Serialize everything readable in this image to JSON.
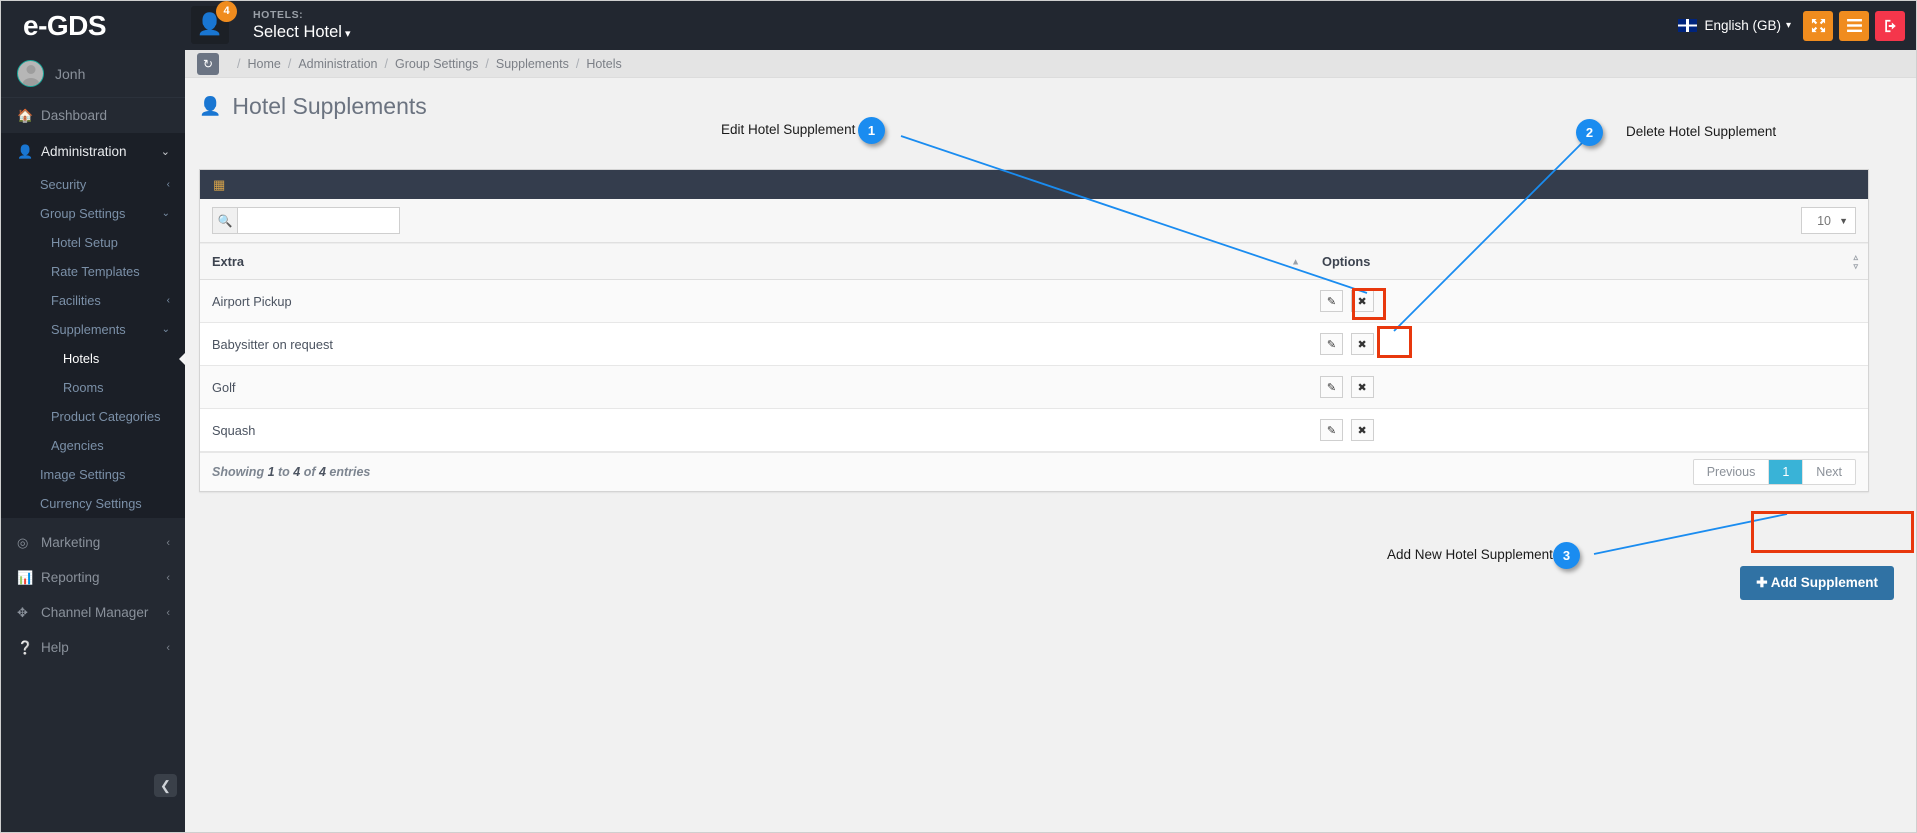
{
  "topbar": {
    "brand": "e-GDS",
    "notification_count": "4",
    "user_icon": "user-icon",
    "hotels_label": "HOTELS:",
    "hotel_selected": "Select Hotel",
    "language": "English (GB)",
    "fullscreen_icon": "expand-icon",
    "menu_icon": "hamburger-icon",
    "logout_icon": "logout-icon"
  },
  "sidebar": {
    "username": "Jonh",
    "items": [
      {
        "label": "Dashboard",
        "icon": "home-icon",
        "chevron": ""
      },
      {
        "label": "Administration",
        "icon": "user-icon",
        "chevron": "⌄"
      }
    ],
    "sub_items": [
      {
        "label": "Security",
        "level": 1,
        "chevron": "‹"
      },
      {
        "label": "Group Settings",
        "level": 1,
        "chevron": "⌄"
      },
      {
        "label": "Hotel Setup",
        "level": 2,
        "chevron": ""
      },
      {
        "label": "Rate Templates",
        "level": 2,
        "chevron": ""
      },
      {
        "label": "Facilities",
        "level": 2,
        "chevron": "‹"
      },
      {
        "label": "Supplements",
        "level": 2,
        "chevron": "⌄"
      },
      {
        "label": "Hotels",
        "level": 3,
        "chevron": "",
        "current": true
      },
      {
        "label": "Rooms",
        "level": 3,
        "chevron": ""
      },
      {
        "label": "Product Categories",
        "level": 2,
        "chevron": ""
      },
      {
        "label": "Agencies",
        "level": 2,
        "chevron": ""
      },
      {
        "label": "Image Settings",
        "level": 1,
        "chevron": ""
      },
      {
        "label": "Currency Settings",
        "level": 1,
        "chevron": ""
      }
    ],
    "bottom_items": [
      {
        "label": "Marketing",
        "icon": "target-icon",
        "chevron": "‹"
      },
      {
        "label": "Reporting",
        "icon": "chart-icon",
        "chevron": "‹"
      },
      {
        "label": "Channel Manager",
        "icon": "move-icon",
        "chevron": "‹"
      },
      {
        "label": "Help",
        "icon": "question-icon",
        "chevron": "‹"
      }
    ],
    "collapse_icon": "collapse-left-icon"
  },
  "breadcrumb": {
    "refresh_icon": "refresh-icon",
    "items": [
      "Home",
      "Administration",
      "Group Settings",
      "Supplements",
      "Hotels"
    ]
  },
  "page": {
    "title": "Hotel Supplements",
    "title_icon": "user-icon"
  },
  "panel": {
    "header_icon": "table-icon",
    "search_placeholder": "",
    "search_value": "",
    "search_icon": "search-icon",
    "page_size": "10",
    "columns": [
      {
        "label": "Extra",
        "sort": "asc"
      },
      {
        "label": "Options",
        "sort": "none"
      }
    ],
    "rows": [
      {
        "extra": "Airport Pickup",
        "edit_icon": "pencil-icon",
        "delete_icon": "times-icon"
      },
      {
        "extra": "Babysitter on request",
        "edit_icon": "pencil-icon",
        "delete_icon": "times-icon"
      },
      {
        "extra": "Golf",
        "edit_icon": "pencil-icon",
        "delete_icon": "times-icon"
      },
      {
        "extra": "Squash",
        "edit_icon": "pencil-icon",
        "delete_icon": "times-icon"
      }
    ],
    "showing_text": "Showing 1 to 4 of 4 entries",
    "pager": {
      "previous": "Previous",
      "current": "1",
      "next": "Next"
    }
  },
  "add_button": {
    "label": "Add Supplement",
    "icon": "plus-icon"
  },
  "annotations": [
    {
      "number": "1",
      "label": "Edit Hotel Supplement"
    },
    {
      "number": "2",
      "label": "Delete Hotel Supplement"
    },
    {
      "number": "3",
      "label": "Add New Hotel Supplement"
    }
  ],
  "colors": {
    "topbar_bg": "#222730",
    "sidebar_bg": "#242932",
    "accent_orange": "#f08c1e",
    "accent_red": "#f5364b",
    "panel_header": "#343d4d",
    "pager_active": "#39b3d7",
    "add_button": "#3072a4",
    "annotation_blue": "#1a8cf0",
    "highlight_red": "#e8380d"
  }
}
